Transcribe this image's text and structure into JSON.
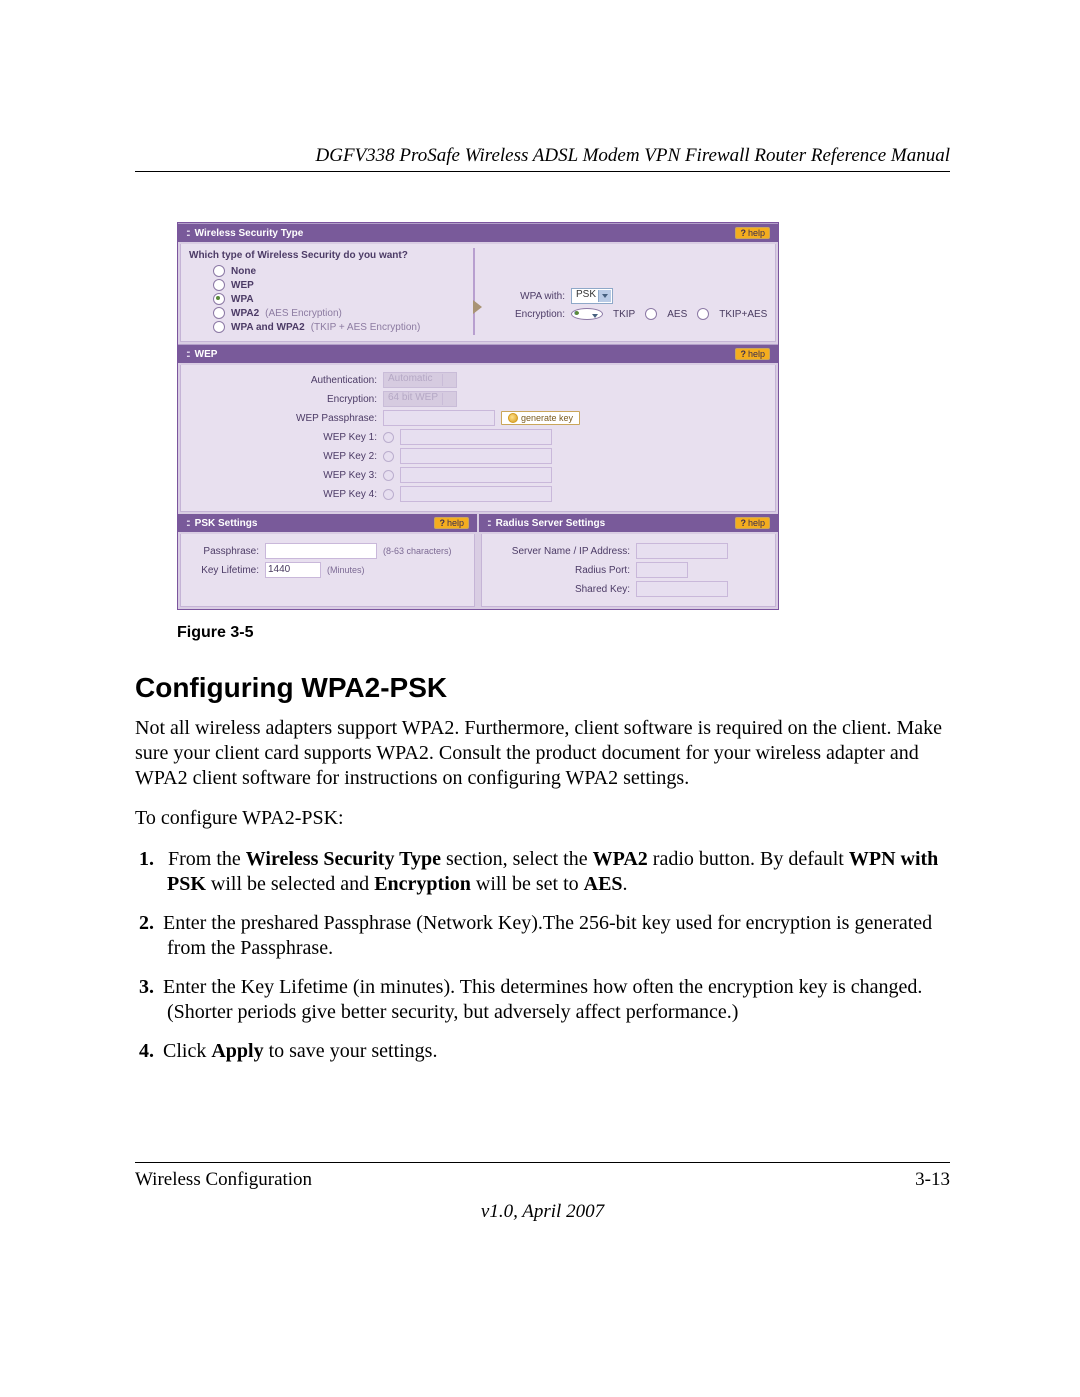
{
  "header": {
    "running_head": "DGFV338 ProSafe Wireless ADSL Modem VPN Firewall Router Reference Manual"
  },
  "figure": {
    "caption": "Figure 3-5",
    "panels": {
      "security_type": {
        "title": "Wireless Security Type",
        "help": "help",
        "question": "Which type of Wireless Security do you want?",
        "options": {
          "none": "None",
          "wep": "WEP",
          "wpa": "WPA",
          "wpa2": "WPA2",
          "wpa2_hint": "(AES Encryption)",
          "wpa12": "WPA and WPA2",
          "wpa12_hint": "(TKIP + AES Encryption)"
        },
        "right": {
          "wpa_with_label": "WPA with:",
          "wpa_with_value": "PSK",
          "encryption_label": "Encryption:",
          "enc_tkip": "TKIP",
          "enc_aes": "AES",
          "enc_both": "TKIP+AES"
        }
      },
      "wep": {
        "title": "WEP",
        "help": "help",
        "auth_label": "Authentication:",
        "auth_value": "Automatic",
        "enc_label": "Encryption:",
        "enc_value": "64 bit WEP",
        "pass_label": "WEP Passphrase:",
        "gen_btn": "generate key",
        "key1": "WEP Key 1:",
        "key2": "WEP Key 2:",
        "key3": "WEP Key 3:",
        "key4": "WEP Key 4:"
      },
      "psk": {
        "title": "PSK Settings",
        "help": "help",
        "pass_label": "Passphrase:",
        "pass_unit": "(8-63 characters)",
        "life_label": "Key Lifetime:",
        "life_value": "1440",
        "life_unit": "(Minutes)"
      },
      "radius": {
        "title": "Radius Server Settings",
        "help": "help",
        "server_label": "Server Name / IP Address:",
        "port_label": "Radius Port:",
        "key_label": "Shared Key:"
      }
    }
  },
  "section": {
    "heading": "Configuring WPA2-PSK",
    "para1": "Not all wireless adapters support WPA2. Furthermore, client software is required on the client. Make sure your client card supports WPA2. Consult the product document for your wireless adapter and WPA2 client software for instructions on configuring WPA2 settings.",
    "para2": "To configure WPA2-PSK:",
    "steps": {
      "s1a": "From the ",
      "s1b": "Wireless Security Type",
      "s1c": " section, select the ",
      "s1d": "WPA2",
      "s1e": " radio button. By default ",
      "s1f": "WPN with PSK",
      "s1g": " will be selected and ",
      "s1h": "Encryption",
      "s1i": " will be set to ",
      "s1j": "AES",
      "s1k": ".",
      "s2": "Enter the preshared Passphrase (Network Key).The 256-bit key used for encryption is generated from the Passphrase.",
      "s3": "Enter the Key Lifetime (in minutes). This determines how often the encryption key is changed. (Shorter periods give better security, but adversely affect performance.)",
      "s4a": "Click ",
      "s4b": "Apply",
      "s4c": " to save your settings."
    }
  },
  "footer": {
    "left": "Wireless Configuration",
    "right": "3-13",
    "version": "v1.0, April 2007"
  }
}
